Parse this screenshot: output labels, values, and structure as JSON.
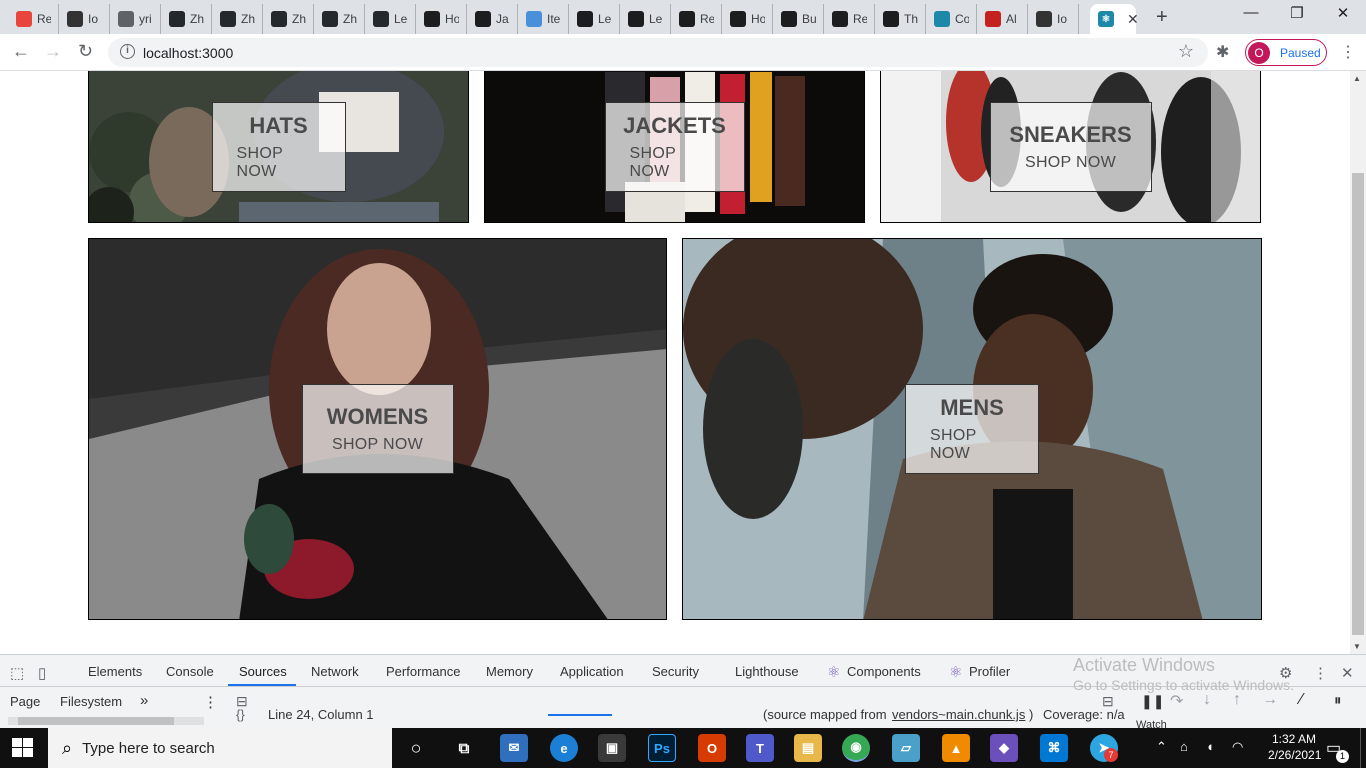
{
  "browser": {
    "tabs": [
      {
        "label": "Re",
        "icon": "react-logo-icon",
        "color": "#e8453c"
      },
      {
        "label": "Io",
        "icon": "cube-icon",
        "color": "#333333"
      },
      {
        "label": "yri",
        "icon": "globe-icon",
        "color": "#5f6368"
      },
      {
        "label": "Zh",
        "icon": "github-icon",
        "color": "#24292e"
      },
      {
        "label": "Zh",
        "icon": "github-icon",
        "color": "#24292e"
      },
      {
        "label": "Zh",
        "icon": "github-icon",
        "color": "#24292e"
      },
      {
        "label": "Zh",
        "icon": "github-icon",
        "color": "#24292e"
      },
      {
        "label": "Le",
        "icon": "github-icon",
        "color": "#24292e"
      },
      {
        "label": "Ho",
        "icon": "udemy-icon",
        "color": "#1c1d1f"
      },
      {
        "label": "Ja",
        "icon": "udemy-icon",
        "color": "#1c1d1f"
      },
      {
        "label": "Ite",
        "icon": "asset-icon",
        "color": "#4a90d9"
      },
      {
        "label": "Le",
        "icon": "udemy-icon",
        "color": "#1c1d1f"
      },
      {
        "label": "Le",
        "icon": "udemy-icon",
        "color": "#1c1d1f"
      },
      {
        "label": "Re",
        "icon": "udemy-icon",
        "color": "#1c1d1f"
      },
      {
        "label": "Ho",
        "icon": "udemy-icon",
        "color": "#1c1d1f"
      },
      {
        "label": "Bu",
        "icon": "udemy-icon",
        "color": "#1c1d1f"
      },
      {
        "label": "Re",
        "icon": "udemy-icon",
        "color": "#1c1d1f"
      },
      {
        "label": "Th",
        "icon": "udemy-icon",
        "color": "#1c1d1f"
      },
      {
        "label": "Co",
        "icon": "react-icon",
        "color": "#1e88a8"
      },
      {
        "label": "Al",
        "icon": "gmail-icon",
        "color": "#c5221f"
      },
      {
        "label": "Io",
        "icon": "cube-icon",
        "color": "#333333"
      }
    ],
    "active_tab_icon": "react-icon",
    "new_tab_label": "+",
    "url": "localhost:3000",
    "profile_initial": "O",
    "profile_status": "Paused"
  },
  "directory": {
    "items": [
      {
        "title": "HATS",
        "subtitle": "SHOP NOW",
        "photo": "hats-photo"
      },
      {
        "title": "JACKETS",
        "subtitle": "SHOP NOW",
        "photo": "jackets-photo"
      },
      {
        "title": "SNEAKERS",
        "subtitle": "SHOP NOW",
        "photo": "sneakers-photo"
      },
      {
        "title": "WOMENS",
        "subtitle": "SHOP NOW",
        "photo": "womens-photo"
      },
      {
        "title": "MENS",
        "subtitle": "SHOP NOW",
        "photo": "mens-photo"
      }
    ]
  },
  "devtools": {
    "tabs": [
      "Elements",
      "Console",
      "Sources",
      "Network",
      "Performance",
      "Memory",
      "Application",
      "Security",
      "Lighthouse",
      "Components",
      "Profiler"
    ],
    "selected_tab": "Sources",
    "left_tabs": [
      "Page",
      "Filesystem"
    ],
    "more_label": "»",
    "status_position": "Line 24, Column 1",
    "source_mapped_prefix": "(source mapped from ",
    "source_mapped_file": "vendors~main.chunk.js",
    "source_mapped_suffix": ")",
    "coverage": "Coverage: n/a",
    "watch_label": "Watch"
  },
  "watermark": {
    "title": "Activate Windows",
    "subtitle": "Go to Settings to activate Windows."
  },
  "taskbar": {
    "search_placeholder": "Type here to search",
    "time": "1:32 AM",
    "date": "2/26/2021",
    "notification_count": "1",
    "telegram_badge": "7"
  }
}
